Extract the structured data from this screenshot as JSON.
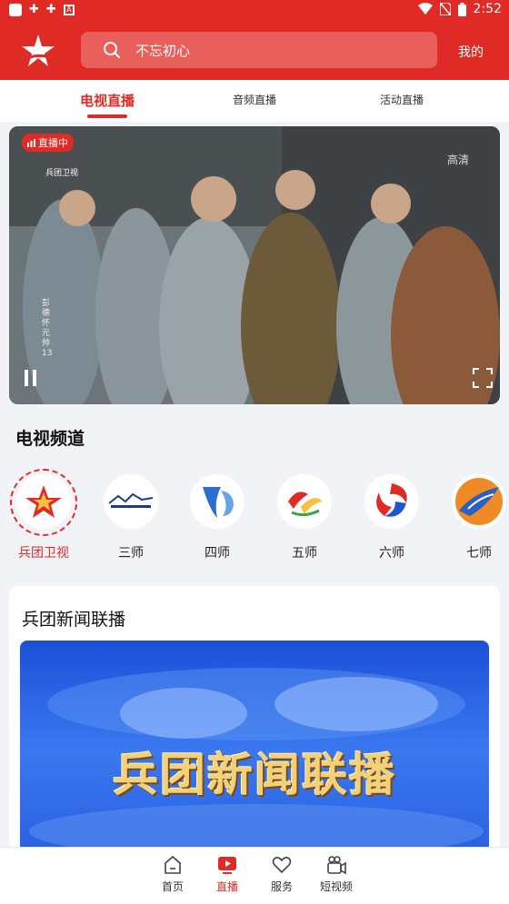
{
  "status_bar": {
    "time": "2:52",
    "left_icons": [
      "app-square-icon",
      "notification-icon",
      "notification-icon",
      "a-icon"
    ],
    "right_icons": [
      "wifi-icon",
      "no-sim-icon",
      "battery-icon"
    ]
  },
  "header": {
    "search_placeholder": "不忘初心",
    "mine_label": "我的",
    "brand_color": "#e02a25"
  },
  "tabs": [
    {
      "label": "电视直播",
      "active": true
    },
    {
      "label": "音频直播",
      "active": false
    },
    {
      "label": "活动直播",
      "active": false
    }
  ],
  "player": {
    "live_badge": "直播中",
    "channel_logo_text": "兵团卫视",
    "quality": "高清",
    "program_text": "彭德怀元帅13"
  },
  "channels_section": {
    "title": "电视频道",
    "items": [
      {
        "label": "兵团卫视",
        "active": true
      },
      {
        "label": "三师",
        "active": false
      },
      {
        "label": "四师",
        "active": false
      },
      {
        "label": "五师",
        "active": false
      },
      {
        "label": "六师",
        "active": false
      },
      {
        "label": "七师",
        "active": false
      }
    ]
  },
  "news_card": {
    "title": "兵团新闻联播",
    "banner_text": "兵团新闻联播"
  },
  "bottom_nav": [
    {
      "label": "首页",
      "icon": "home-icon",
      "active": false
    },
    {
      "label": "直播",
      "icon": "live-tv-icon",
      "active": true
    },
    {
      "label": "服务",
      "icon": "heart-icon",
      "active": false
    },
    {
      "label": "短视频",
      "icon": "short-video-icon",
      "active": false
    }
  ]
}
